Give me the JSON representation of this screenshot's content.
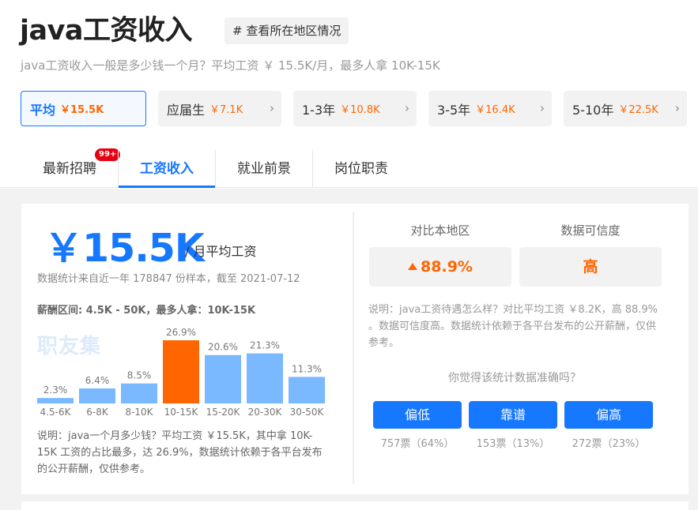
{
  "header": {
    "title": "java工资收入",
    "region_button": "# 查看所在地区情况",
    "subtitle": "java工资收入一般是多少钱一个月？平均工资 ￥ 15.5K/月，最多人拿 10K-15K"
  },
  "experience_tabs": [
    {
      "label": "平均",
      "value": "￥15.5K"
    },
    {
      "label": "应届生",
      "value": "￥7.1K"
    },
    {
      "label": "1-3年",
      "value": "￥10.8K"
    },
    {
      "label": "3-5年",
      "value": "￥16.4K"
    },
    {
      "label": "5-10年",
      "value": "￥22.5K"
    }
  ],
  "nav": {
    "tabs": [
      "最新招聘",
      "工资收入",
      "就业前景",
      "岗位职责"
    ],
    "badge": "99+"
  },
  "left": {
    "salary": "￥15.5K",
    "unit": "/ 月平均工资",
    "stat_note": "数据统计来自近一年 178847 份样本，截至 2021-07-12",
    "range_note": "薪酬区间: 4.5K - 50K，最多人拿：10K-15K",
    "watermark": "职友集",
    "explain": "说明：java一个月多少钱？平均工资 ￥15.5K，其中拿 10K-15K 工资的占比最多，达 26.9%，数据统计依赖于各平台发布的公开薪酬，仅供参考。"
  },
  "chart_data": {
    "type": "bar",
    "categories": [
      "4.5-6K",
      "6-8K",
      "8-10K",
      "10-15K",
      "15-20K",
      "20-30K",
      "30-50K"
    ],
    "values": [
      2.3,
      6.4,
      8.5,
      26.9,
      20.6,
      21.3,
      11.3
    ],
    "labels": [
      "2.3%",
      "6.4%",
      "8.5%",
      "26.9%",
      "20.6%",
      "21.3%",
      "11.3%"
    ],
    "highlight_index": 3,
    "colors": {
      "normal": "#7ab8ff",
      "highlight": "#ff6600"
    }
  },
  "right": {
    "compare_label": "对比本地区",
    "compare_value": "88.9%",
    "credibility_label": "数据可信度",
    "credibility_value": "高",
    "explain": "说明：java工资待遇怎么样？对比平均工资 ￥8.2K，高 88.9% 。数据可信度高。数据统计依赖于各平台发布的公开薪酬，仅供参考。",
    "question": "你觉得该统计数据准确吗？",
    "votes": [
      {
        "label": "偏低",
        "count": "757票（64%）"
      },
      {
        "label": "靠谱",
        "count": "153票（13%）"
      },
      {
        "label": "偏高",
        "count": "272票（23%）"
      }
    ]
  },
  "colors": {
    "accent": "#1677ff",
    "orange": "#ff6600",
    "badge": "#e60012"
  }
}
